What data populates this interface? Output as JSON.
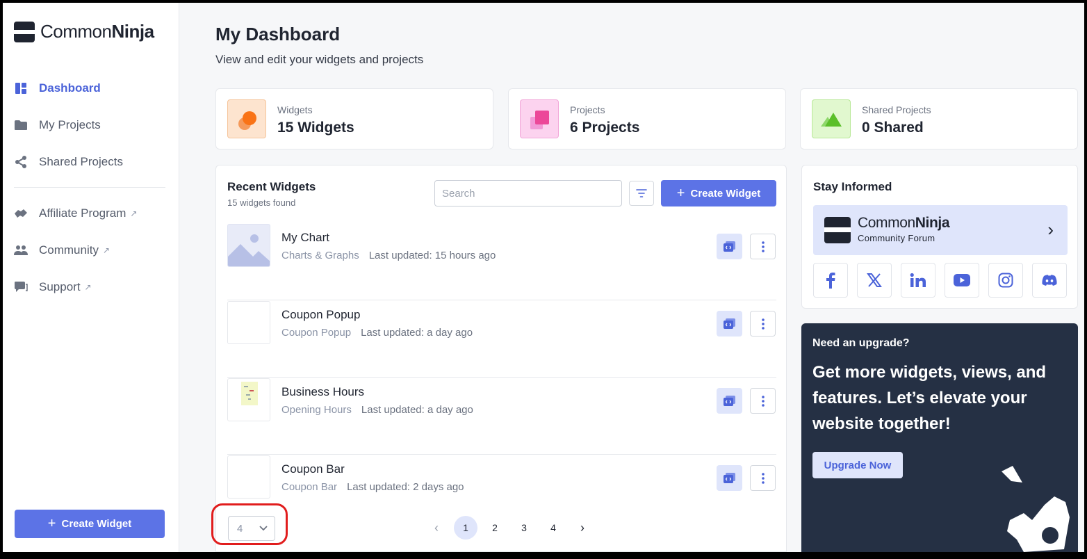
{
  "brand": {
    "name_light": "Common",
    "name_bold": "Ninja"
  },
  "sidebar": {
    "items": [
      {
        "label": "Dashboard",
        "icon": "dashboard-icon",
        "active": true
      },
      {
        "label": "My Projects",
        "icon": "folder-icon"
      },
      {
        "label": "Shared Projects",
        "icon": "share-icon"
      }
    ],
    "external_items": [
      {
        "label": "Affiliate Program",
        "icon": "handshake-icon"
      },
      {
        "label": "Community",
        "icon": "users-icon"
      },
      {
        "label": "Support",
        "icon": "chat-icon"
      }
    ],
    "create_label": "Create Widget"
  },
  "header": {
    "title": "My Dashboard",
    "subtitle": "View and edit your widgets and projects"
  },
  "stats": [
    {
      "label": "Widgets",
      "value": "15 Widgets",
      "color": "#f97316"
    },
    {
      "label": "Projects",
      "value": "6 Projects",
      "color": "#ec4899"
    },
    {
      "label": "Shared Projects",
      "value": "0 Shared",
      "color": "#65c232"
    }
  ],
  "recent": {
    "title": "Recent Widgets",
    "count": "15 widgets found",
    "search_placeholder": "Search",
    "create_label": "Create Widget",
    "widgets": [
      {
        "name": "My Chart",
        "category": "Charts & Graphs",
        "updated": "Last updated: 15 hours ago"
      },
      {
        "name": "Coupon Popup",
        "category": "Coupon Popup",
        "updated": "Last updated: a day ago"
      },
      {
        "name": "Business Hours",
        "category": "Opening Hours",
        "updated": "Last updated: a day ago"
      },
      {
        "name": "Coupon Bar",
        "category": "Coupon Bar",
        "updated": "Last updated: 2 days ago"
      }
    ],
    "per_page": "4",
    "pages": [
      "1",
      "2",
      "3",
      "4"
    ],
    "current_page": "1"
  },
  "informed": {
    "title": "Stay Informed",
    "forum_brand_light": "Common",
    "forum_brand_bold": "Ninja",
    "forum_subtitle": "Community Forum",
    "socials": [
      "facebook-icon",
      "x-icon",
      "linkedin-icon",
      "youtube-icon",
      "instagram-icon",
      "discord-icon"
    ]
  },
  "upgrade": {
    "kicker": "Need an upgrade?",
    "headline": "Get more widgets, views, and features. Let’s elevate your website together!",
    "button": "Upgrade Now"
  },
  "colors": {
    "accent": "#5c73e6",
    "dark_panel": "#253044",
    "highlight": "#e11d1d"
  }
}
